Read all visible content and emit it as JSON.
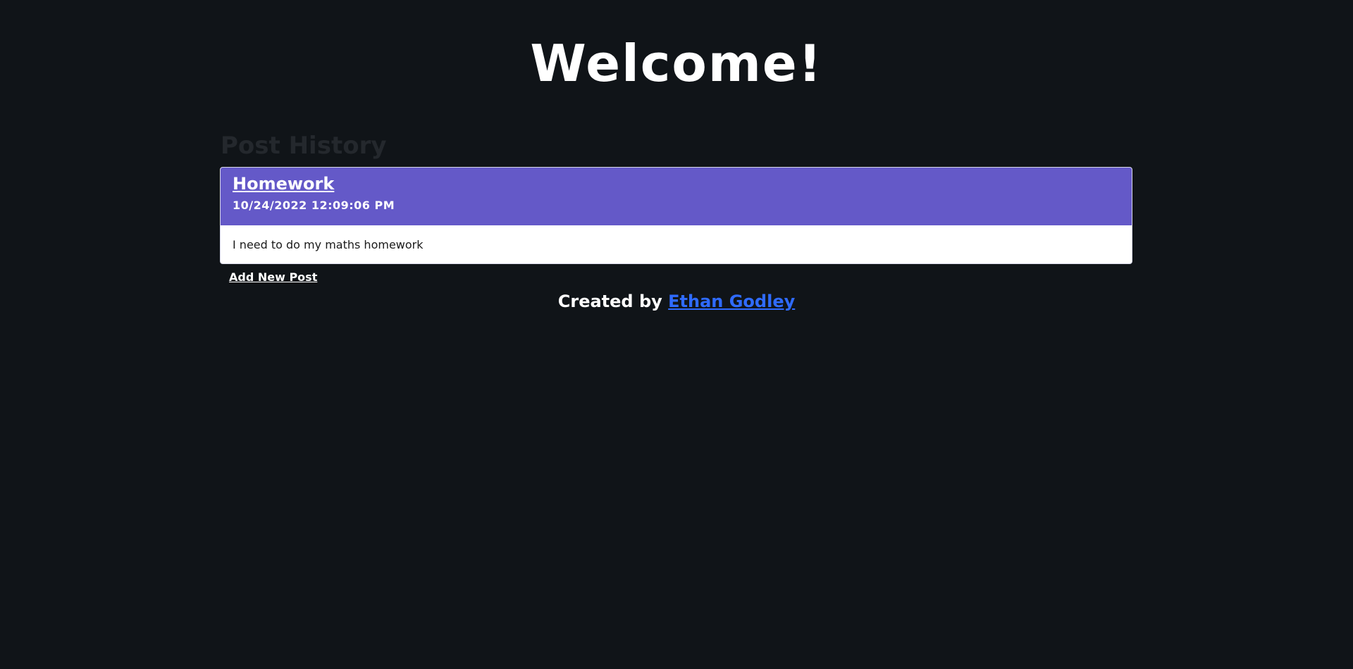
{
  "header": {
    "title": "Welcome!"
  },
  "history": {
    "title": "Post History",
    "posts": [
      {
        "title": "Homework",
        "date": "10/24/2022 12:09:06 PM",
        "body": "I need to do my maths homework"
      }
    ]
  },
  "actions": {
    "add_post_label": "Add New Post"
  },
  "footer": {
    "prefix": "Created by",
    "author": "Ethan Godley"
  },
  "colors": {
    "background": "#101418",
    "card_header": "#6459c8",
    "link": "#2f6bff"
  }
}
